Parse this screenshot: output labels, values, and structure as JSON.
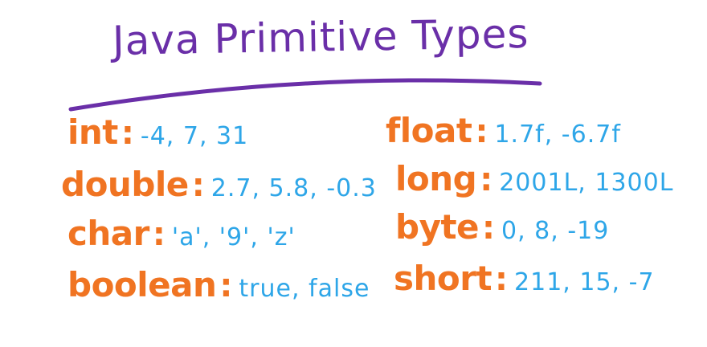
{
  "title": "Java Primitive Types",
  "colors": {
    "title": "#6a2fa8",
    "keyword": "#f07422",
    "values": "#2ea6e8",
    "background": "#ffffff"
  },
  "left_column": [
    {
      "type": "int",
      "colon": ":",
      "values": "-4, 7, 31"
    },
    {
      "type": "double",
      "colon": ":",
      "values": "2.7, 5.8, -0.3"
    },
    {
      "type": "char",
      "colon": ":",
      "values": "'a', '9', 'z'"
    },
    {
      "type": "boolean",
      "colon": ":",
      "values": "true, false"
    }
  ],
  "right_column": [
    {
      "type": "float",
      "colon": ":",
      "values": "1.7f, -6.7f"
    },
    {
      "type": "long",
      "colon": ":",
      "values": "2001L, 1300L"
    },
    {
      "type": "byte",
      "colon": ":",
      "values": "0, 8, -19"
    },
    {
      "type": "short",
      "colon": ":",
      "values": "211, 15, -7"
    }
  ]
}
